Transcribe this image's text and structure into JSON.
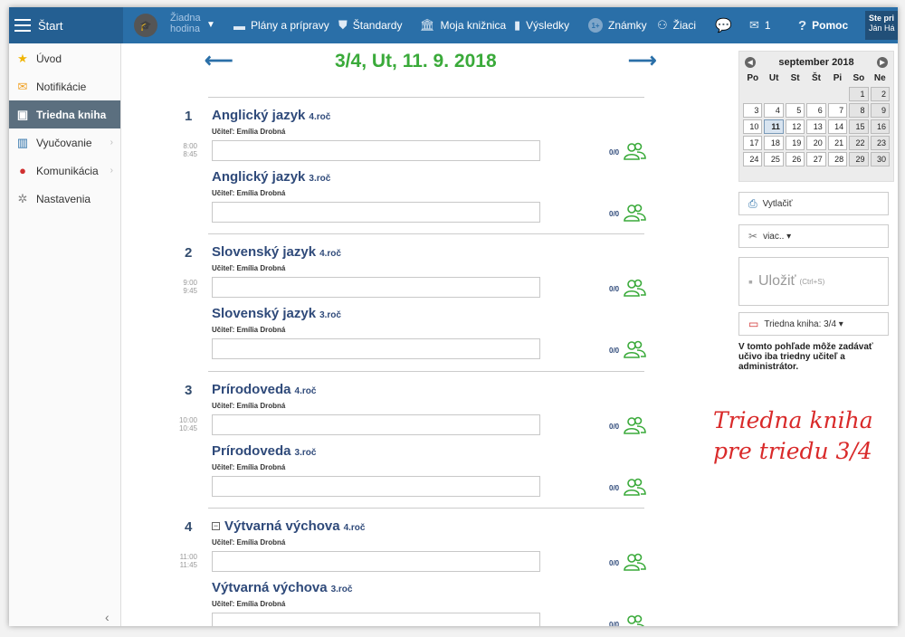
{
  "topbar": {
    "start_label": "Štart",
    "hour_label_line1": "Žiadna",
    "hour_label_line2": "hodina",
    "nav": [
      {
        "label": "Plány a prípravy",
        "icon": "briefcase-icon"
      },
      {
        "label": "Štandardy",
        "icon": "shield-icon"
      },
      {
        "label": "Moja knižnica",
        "icon": "library-icon"
      },
      {
        "label": "Výsledky",
        "icon": "bar-chart-icon"
      },
      {
        "label": "Známky",
        "icon": "grade-badge-icon"
      },
      {
        "label": "Žiaci",
        "icon": "students-icon"
      }
    ],
    "messages_count": "1",
    "help_label": "Pomoc",
    "user_line1": "Ste pri",
    "user_line2": "Ján Há"
  },
  "sidebar": {
    "items": [
      {
        "label": "Úvod",
        "icon": "star-icon"
      },
      {
        "label": "Notifikácie",
        "icon": "envelope-icon"
      },
      {
        "label": "Triedna kniha",
        "icon": "book-icon"
      },
      {
        "label": "Vyučovanie",
        "icon": "open-book-icon"
      },
      {
        "label": "Komunikácia",
        "icon": "chat-icon"
      },
      {
        "label": "Nastavenia",
        "icon": "gear-icon"
      }
    ],
    "collapse_glyph": "‹"
  },
  "main": {
    "date_title": "3/4, Ut, 11. 9. 2018",
    "periods": [
      {
        "num": "1",
        "start": "8:00",
        "end": "8:45",
        "lessons": [
          {
            "subject": "Anglický jazyk",
            "grade": "4.roč",
            "teacher": "Učiteľ: Emília Drobná",
            "count": "0/0"
          },
          {
            "subject": "Anglický jazyk",
            "grade": "3.roč",
            "teacher": "Učiteľ: Emília Drobná",
            "count": "0/0"
          }
        ]
      },
      {
        "num": "2",
        "start": "9:00",
        "end": "9:45",
        "lessons": [
          {
            "subject": "Slovenský jazyk",
            "grade": "4.roč",
            "teacher": "Učiteľ: Emília Drobná",
            "count": "0/0"
          },
          {
            "subject": "Slovenský jazyk",
            "grade": "3.roč",
            "teacher": "Učiteľ: Emília Drobná",
            "count": "0/0"
          }
        ]
      },
      {
        "num": "3",
        "start": "10:00",
        "end": "10:45",
        "lessons": [
          {
            "subject": "Prírodoveda",
            "grade": "4.roč",
            "teacher": "Učiteľ: Emília Drobná",
            "count": "0/0"
          },
          {
            "subject": "Prírodoveda",
            "grade": "3.roč",
            "teacher": "Učiteľ: Emília Drobná",
            "count": "0/0"
          }
        ]
      },
      {
        "num": "4",
        "start": "11:00",
        "end": "11:45",
        "lessons": [
          {
            "subject": "Výtvarná výchova",
            "grade": "4.roč",
            "teacher": "Učiteľ: Emília Drobná",
            "count": "0/0"
          },
          {
            "subject": "Výtvarná výchova",
            "grade": "3.roč",
            "teacher": "Učiteľ: Emília Drobná",
            "count": "0/0"
          }
        ]
      }
    ]
  },
  "calendar": {
    "month_label": "september 2018",
    "days_of_week": [
      "Po",
      "Ut",
      "St",
      "Št",
      "Pi",
      "So",
      "Ne"
    ],
    "leading_blanks": 5,
    "days_in_month": 30,
    "selected_day": 11
  },
  "right_panel": {
    "print_label": "Vytlačiť",
    "more_label": "viac.. ▾",
    "save_label": "Uložiť",
    "save_shortcut": "(Ctrl+S)",
    "book_select_label": "Triedna kniha: 3/4 ▾",
    "info_text": "V tomto pohľade môže zadávať učivo iba triedny učiteľ a administrátor."
  },
  "annotation": {
    "line1": "Triedna kniha",
    "line2": "pre triedu 3/4"
  },
  "colors": {
    "topbar": "#2a6fa8",
    "date_title": "#3aaa3a",
    "sidebar_active": "#5b6f7f",
    "subject": "#2f4a7a",
    "annotation": "#d92a2a",
    "people_icon": "#3aaa3a"
  }
}
